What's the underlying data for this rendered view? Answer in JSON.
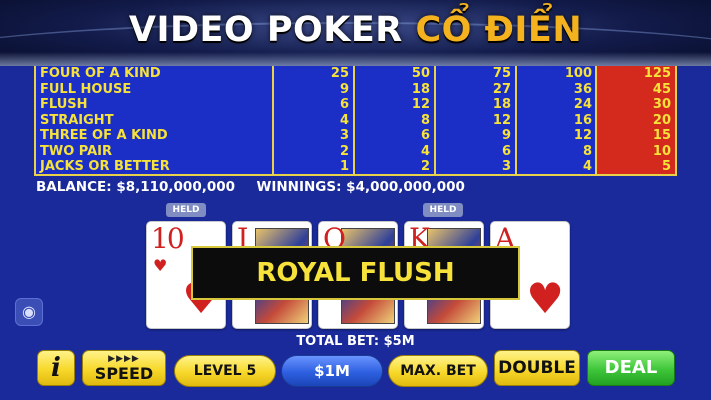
{
  "header": {
    "title_white": "VIDEO POKER ",
    "title_gold": "CỔ ĐIỂN"
  },
  "paytable": {
    "rows": [
      {
        "name": "FOUR OF A KIND",
        "values": [
          "25",
          "50",
          "75",
          "100",
          "125"
        ]
      },
      {
        "name": "FULL HOUSE",
        "values": [
          "9",
          "18",
          "27",
          "36",
          "45"
        ]
      },
      {
        "name": "FLUSH",
        "values": [
          "6",
          "12",
          "18",
          "24",
          "30"
        ]
      },
      {
        "name": "STRAIGHT",
        "values": [
          "4",
          "8",
          "12",
          "16",
          "20"
        ]
      },
      {
        "name": "THREE OF A KIND",
        "values": [
          "3",
          "6",
          "9",
          "12",
          "15"
        ]
      },
      {
        "name": "TWO PAIR",
        "values": [
          "2",
          "4",
          "6",
          "8",
          "10"
        ]
      },
      {
        "name": "JACKS OR BETTER",
        "values": [
          "1",
          "2",
          "3",
          "4",
          "5"
        ]
      }
    ]
  },
  "status": {
    "balance": "BALANCE: $8,110,000,000",
    "winnings": "WINNINGS: $4,000,000,000",
    "total_bet": "TOTAL BET: $5M"
  },
  "held_badges": [
    "HELD",
    "HELD"
  ],
  "cards": [
    {
      "rank": "10",
      "suit": "♥",
      "face": false
    },
    {
      "rank": "J",
      "suit": "♥",
      "face": true
    },
    {
      "rank": "Q",
      "suit": "♥",
      "face": true
    },
    {
      "rank": "K",
      "suit": "♥",
      "face": true
    },
    {
      "rank": "A",
      "suit": "♥",
      "face": false
    }
  ],
  "result_banner": "ROYAL FLUSH",
  "buttons": {
    "info": "i",
    "speed": "SPEED",
    "speed_indicator": "▶▶▶▶",
    "level": "LEVEL 5",
    "bet": "$1M",
    "max_bet": "MAX. BET",
    "double": "DOUBLE",
    "deal": "DEAL"
  },
  "side_icon": "◉",
  "colors": {
    "background": "#1a2a9a",
    "paytable_bg": "#1b2fc6",
    "paytable_text": "#f6e23a",
    "highlight_column": "#d42a1e",
    "title_gold": "#f4b21f",
    "deal_green": "#3ec63a"
  }
}
